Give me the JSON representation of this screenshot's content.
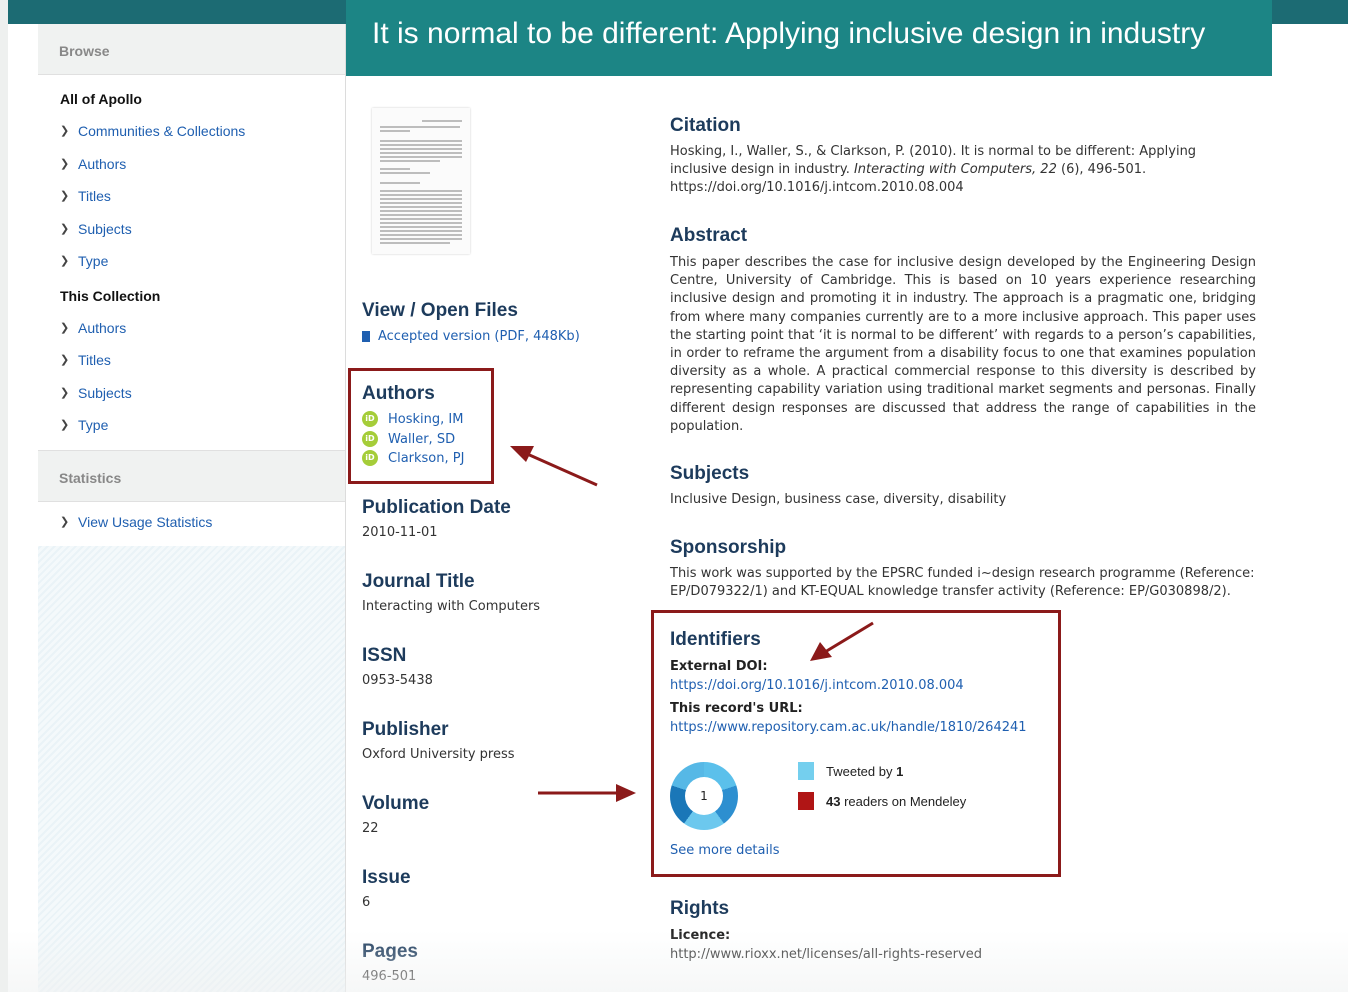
{
  "title": "It is normal to be different: Applying inclusive design in industry",
  "sidebar": {
    "browse_heading": "Browse",
    "all_heading": "All of Apollo",
    "all_items": [
      "Communities & Collections",
      "Authors",
      "Titles",
      "Subjects",
      "Type"
    ],
    "collection_heading": "This Collection",
    "collection_items": [
      "Authors",
      "Titles",
      "Subjects",
      "Type"
    ],
    "stats_heading": "Statistics",
    "stats_item": "View Usage Statistics"
  },
  "files": {
    "heading": "View / Open Files",
    "link": "Accepted version (PDF, 448Kb)"
  },
  "authors": {
    "heading": "Authors",
    "badge": "iD",
    "list": [
      "Hosking, IM",
      "Waller, SD",
      "Clarkson, PJ"
    ]
  },
  "meta": {
    "pubdate_heading": "Publication Date",
    "pubdate": "2010-11-01",
    "journal_heading": "Journal Title",
    "journal": "Interacting with Computers",
    "issn_heading": "ISSN",
    "issn": "0953-5438",
    "publisher_heading": "Publisher",
    "publisher": "Oxford University press",
    "volume_heading": "Volume",
    "volume": "22",
    "issue_heading": "Issue",
    "issue": "6",
    "pages_heading": "Pages",
    "pages": "496-501"
  },
  "citation": {
    "heading": "Citation",
    "pre": "Hosking, I., Waller, S., & Clarkson, P. (2010). It is normal to be different: Applying inclusive design in industry. ",
    "journal": "Interacting with Computers, 22",
    "post": " (6), 496-501. https://doi.org/10.1016/j.intcom.2010.08.004"
  },
  "abstract": {
    "heading": "Abstract",
    "text": "This paper describes the case for inclusive design developed by the Engineering Design Centre, University of Cambridge. This is based on 10 years experience researching inclusive design and promoting it in industry. The approach is a pragmatic one, bridging from where many companies currently are to a more inclusive approach. This paper uses the starting point that ‘it is normal to be different’ with regards to a person’s capabilities, in order to reframe the argument from a disability focus to one that examines population diversity as a whole. A practical commercial response to this diversity is described by representing capability variation using traditional market segments and personas. Finally different design responses are discussed that address the range of capabilities in the population."
  },
  "subjects": {
    "heading": "Subjects",
    "text": "Inclusive Design, business case, diversity, disability"
  },
  "sponsorship": {
    "heading": "Sponsorship",
    "text": "This work was supported by the EPSRC funded i~design research programme (Reference: EP/D079322/1) and KT-EQUAL knowledge transfer activity (Reference: EP/G030898/2)."
  },
  "identifiers": {
    "heading": "Identifiers",
    "doi_label": "External DOI:",
    "doi": "https://doi.org/10.1016/j.intcom.2010.08.004",
    "url_label": "This record's URL:",
    "url": "https://www.repository.cam.ac.uk/handle/1810/264241"
  },
  "altmetric": {
    "score": "1",
    "tweeted_pre": "Tweeted by ",
    "tweeted_count": "1",
    "readers_count": "43",
    "readers_post": " readers on Mendeley",
    "more": "See more details",
    "colors": {
      "twitter": "#74cfee",
      "mendeley": "#b01515"
    }
  },
  "rights": {
    "heading": "Rights",
    "licence_label": "Licence:",
    "licence": "http://www.rioxx.net/licenses/all-rights-reserved"
  },
  "colors": {
    "banner": "#1c8585",
    "heading": "#1d3b5c",
    "link": "#1f5fb0",
    "highlight": "#8b1a1a",
    "orcid": "#a5cd39"
  }
}
